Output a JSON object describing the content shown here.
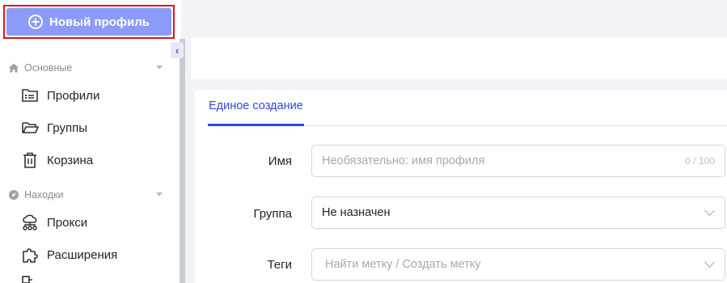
{
  "sidebar": {
    "new_profile_label": "Новый профиль",
    "sections": [
      {
        "title": "Основные",
        "icon": "home-icon"
      },
      {
        "title": "Находки",
        "icon": "compass-icon"
      }
    ],
    "main_items": [
      {
        "label": "Профили",
        "icon": "profiles-icon"
      },
      {
        "label": "Группы",
        "icon": "folder-icon"
      },
      {
        "label": "Корзина",
        "icon": "trash-icon"
      }
    ],
    "finds_items": [
      {
        "label": "Прокси",
        "icon": "proxy-icon"
      },
      {
        "label": "Расширения",
        "icon": "puzzle-icon"
      }
    ]
  },
  "main": {
    "tab_label": "Единое создание",
    "form": {
      "name_label": "Имя",
      "name_placeholder": "Необязательно: имя профиля",
      "name_counter": "0 / 100",
      "group_label": "Группа",
      "group_value": "Не назначен",
      "tags_label": "Теги",
      "tags_placeholder": "Найти метку / Создать метку"
    }
  },
  "colors": {
    "accent": "#3148d8",
    "button_bg": "#8d9af8",
    "highlight_border": "#e0141e"
  }
}
